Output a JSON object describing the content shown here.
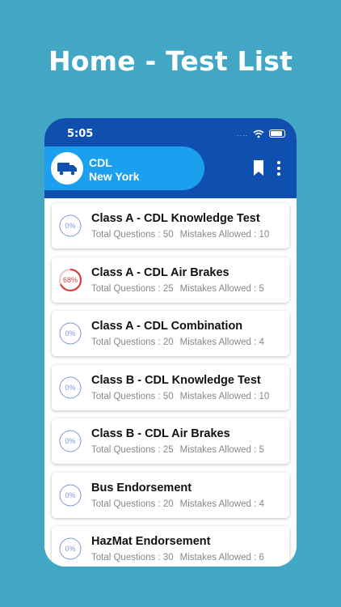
{
  "headline": "Home - Test List",
  "status_bar": {
    "time": "5:05",
    "signal_dots": "...."
  },
  "header": {
    "title": "CDL",
    "subtitle": "New York"
  },
  "tests": [
    {
      "title": "Class A - CDL Knowledge Test",
      "progress": "0%",
      "progress_value": 0,
      "total_questions": "Total Questions : 50",
      "mistakes_allowed": "Mistakes Allowed : 10"
    },
    {
      "title": "Class A - CDL Air Brakes",
      "progress": "68%",
      "progress_value": 68,
      "total_questions": "Total Questions : 25",
      "mistakes_allowed": "Mistakes Allowed : 5"
    },
    {
      "title": "Class A - CDL Combination",
      "progress": "0%",
      "progress_value": 0,
      "total_questions": "Total Questions : 20",
      "mistakes_allowed": "Mistakes Allowed : 4"
    },
    {
      "title": "Class B - CDL Knowledge Test",
      "progress": "0%",
      "progress_value": 0,
      "total_questions": "Total Questions : 50",
      "mistakes_allowed": "Mistakes Allowed : 10"
    },
    {
      "title": "Class B - CDL Air Brakes",
      "progress": "0%",
      "progress_value": 0,
      "total_questions": "Total Questions : 25",
      "mistakes_allowed": "Mistakes Allowed : 5"
    },
    {
      "title": "Bus Endorsement",
      "progress": "0%",
      "progress_value": 0,
      "total_questions": "Total Questions : 20",
      "mistakes_allowed": "Mistakes Allowed : 4"
    },
    {
      "title": "HazMat Endorsement",
      "progress": "0%",
      "progress_value": 0,
      "total_questions": "Total Questions : 30",
      "mistakes_allowed": "Mistakes Allowed : 6"
    }
  ],
  "colors": {
    "background": "#42a7c4",
    "header": "#0e4fb0",
    "pill": "#1aa0ee",
    "ring_idle": "#7d97d2",
    "ring_progress": "#d94040"
  },
  "icons": {
    "header_avatar": "truck-icon",
    "bookmark": "bookmark-icon",
    "menu": "more-vertical-icon",
    "wifi": "wifi-icon",
    "battery": "battery-icon"
  }
}
